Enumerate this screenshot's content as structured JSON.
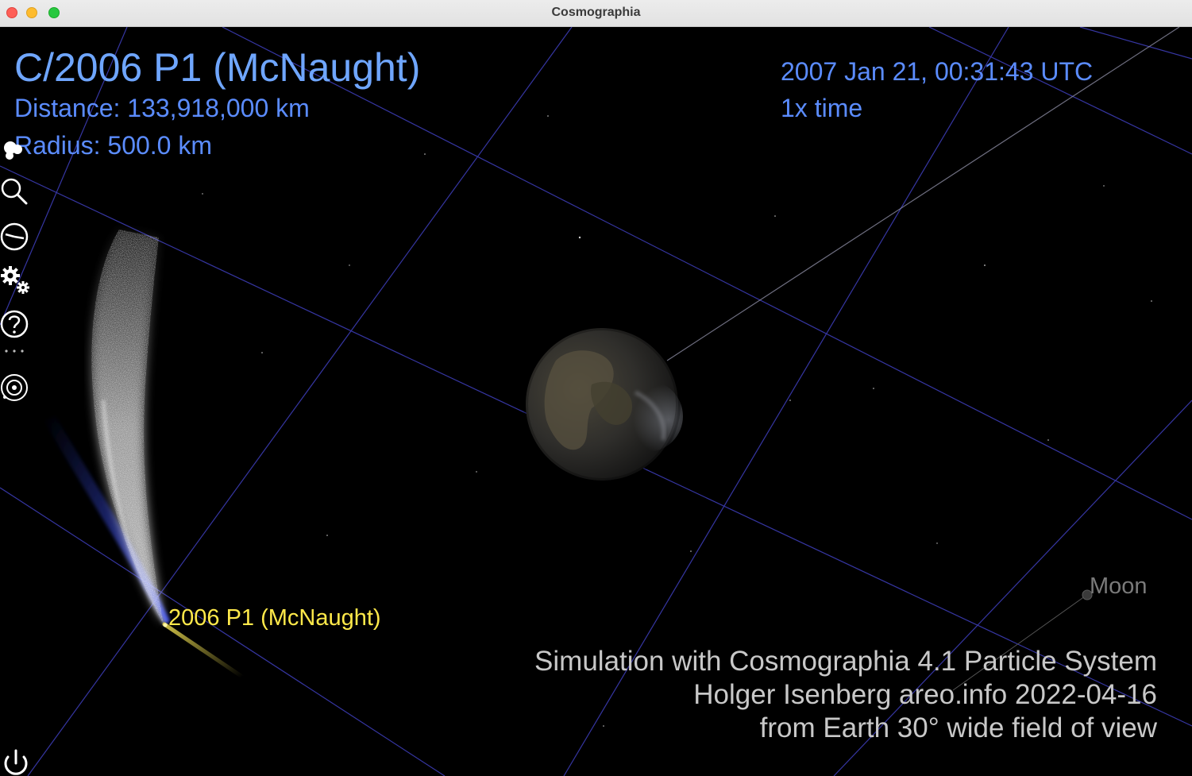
{
  "window": {
    "title": "Cosmographia"
  },
  "hud": {
    "object_name": "C/2006 P1 (McNaught)",
    "distance": "Distance: 133,918,000 km",
    "radius": "Radius: 500.0 km",
    "datetime": "2007 Jan 21, 00:31:43 UTC",
    "time_rate": "1x time"
  },
  "toolbar": {
    "items": [
      {
        "icon": "bodies-icon"
      },
      {
        "icon": "search-icon"
      },
      {
        "icon": "clock-icon"
      },
      {
        "icon": "gears-icon"
      },
      {
        "icon": "help-icon"
      },
      {
        "icon": "more-dots-icon"
      },
      {
        "icon": "observer-icon"
      }
    ],
    "power_icon": "power-icon"
  },
  "scene": {
    "comet_label": "2006 P1 (McNaught)",
    "moon_label": "Moon",
    "credits": [
      "Simulation with Cosmographia 4.1 Particle System",
      "Holger Isenberg  areo.info  2022-04-16",
      "from Earth 30° wide field of view"
    ]
  },
  "colors": {
    "hud_title": "#6fa6ff",
    "hud_text": "#5b8cff",
    "grid": "#3c3cb4",
    "comet_label": "#ffe94a",
    "credits": "#c8c8c8"
  }
}
